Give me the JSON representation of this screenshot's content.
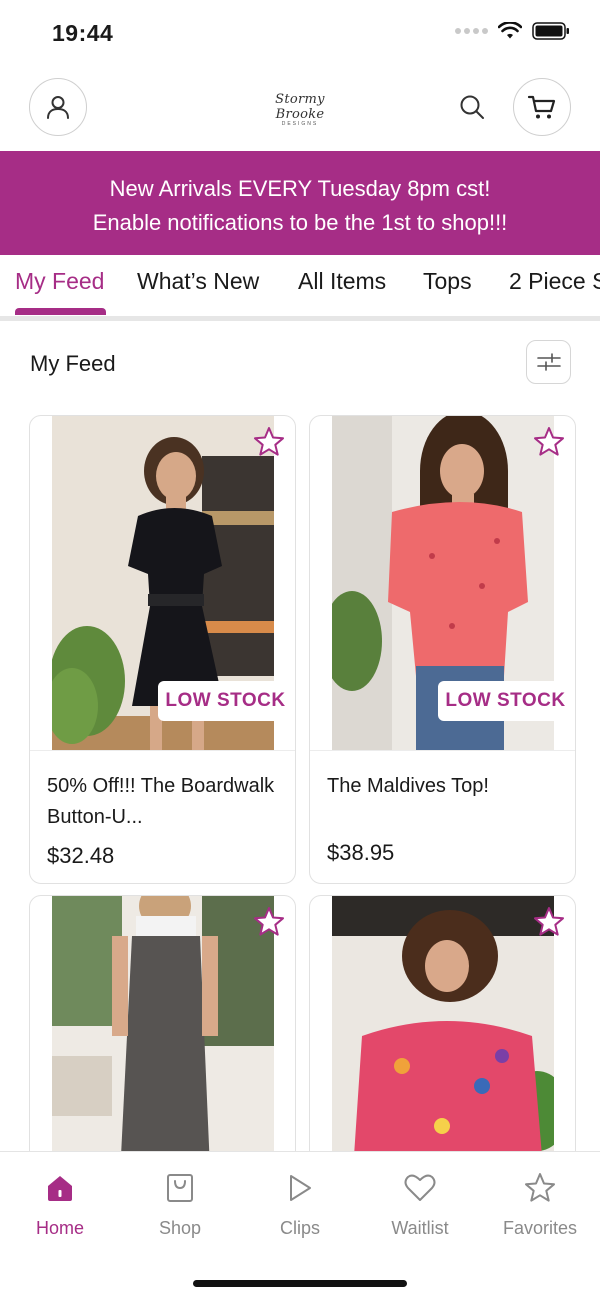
{
  "status": {
    "time": "19:44"
  },
  "header": {
    "logo_text": "Stormy Brooke",
    "logo_subtext": "DESIGNS"
  },
  "banner": {
    "line1": "New Arrivals EVERY Tuesday 8pm cst!",
    "line2": "Enable notifications to be the 1st to shop!!!"
  },
  "tabs": [
    {
      "label": "My Feed",
      "active": true
    },
    {
      "label": "What’s New",
      "active": false
    },
    {
      "label": "All Items",
      "active": false
    },
    {
      "label": "Tops",
      "active": false
    },
    {
      "label": "2 Piece S",
      "active": false
    }
  ],
  "section": {
    "title": "My Feed"
  },
  "products": [
    {
      "name": "50% Off!!! The Boardwalk Button-U...",
      "price": "$32.48",
      "badge": "LOW STOCK"
    },
    {
      "name": "The Maldives Top!",
      "price": "$38.95",
      "badge": "LOW STOCK"
    },
    {
      "name": "",
      "price": "",
      "badge": ""
    },
    {
      "name": "",
      "price": "",
      "badge": ""
    }
  ],
  "bottom_nav": [
    {
      "label": "Home",
      "icon": "home-icon",
      "active": true
    },
    {
      "label": "Shop",
      "icon": "shopping-bag-icon",
      "active": false
    },
    {
      "label": "Clips",
      "icon": "play-icon",
      "active": false
    },
    {
      "label": "Waitlist",
      "icon": "heart-icon",
      "active": false
    },
    {
      "label": "Favorites",
      "icon": "star-icon",
      "active": false
    }
  ],
  "colors": {
    "accent": "#a62d86",
    "inactive": "#8a8a8a"
  }
}
